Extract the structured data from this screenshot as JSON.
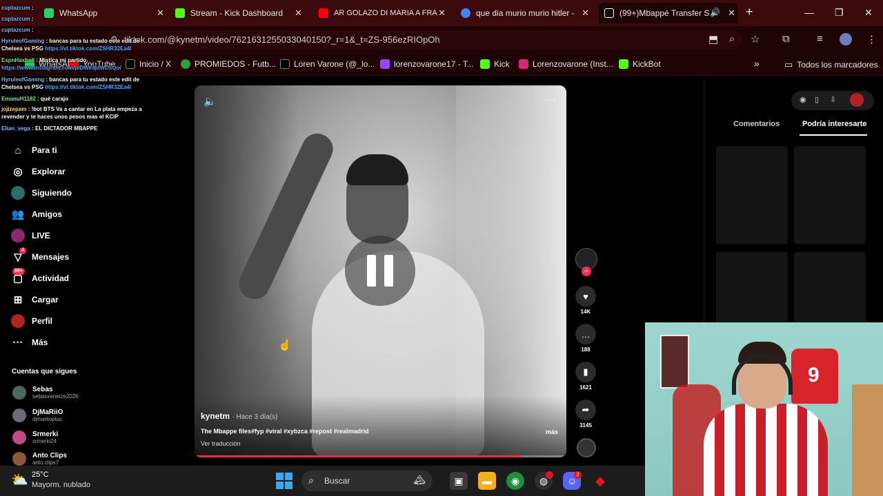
{
  "tabs": [
    {
      "label": "WhatsApp",
      "color": "#25d366"
    },
    {
      "label": "Stream - Kick Dashboard",
      "color": "#53fc18"
    },
    {
      "label": "AR GOLAZO DI MARIA A FRA",
      "color": "#ff0000"
    },
    {
      "label": "que dia murio murio hitler -",
      "color": "#4285f4"
    },
    {
      "label": "(99+)Mbappé Transfer S",
      "color": "#111111"
    }
  ],
  "address": {
    "url": "tiktok.com/@kynetm/video/7621631255033040150?_r=1&_t=ZS-956ezRIOpOh"
  },
  "bookmarks": [
    {
      "label": "WhatsApp",
      "color": "#25d366"
    },
    {
      "label": "YouTube",
      "color": "#ff0000"
    },
    {
      "label": "Inicio / X",
      "color": "#000000"
    },
    {
      "label": "PROMIEDOS - Futb...",
      "color": "#2e9d3a"
    },
    {
      "label": "Loren Varone (@_lo...",
      "color": "#000000"
    },
    {
      "label": "lorenzovarone17 - T...",
      "color": "#9146ff"
    },
    {
      "label": "Kick",
      "color": "#53fc18"
    },
    {
      "label": "Lorenzovarone (Inst...",
      "color": "#d62976"
    },
    {
      "label": "KickBot",
      "color": "#53fc18"
    }
  ],
  "all_bookmarks": "Todos los marcadores",
  "chat": [
    {
      "user": "cuptazcum",
      "msg": ":",
      "link": ""
    },
    {
      "user": "cuptazcum",
      "msg": ":",
      "link": ""
    },
    {
      "user": "cuptazcum",
      "msg": ":",
      "link": ""
    },
    {
      "user": "HyruleofGaming",
      "msg": ": bancas para tu estado este edit de Chelsea vs PSG",
      "link": "https://vt.tiktok.com/ZSHR32Ea4/"
    },
    {
      "user": "EspnHaxball",
      "msg": ": Mistica mi partido",
      "link": "https://www.instagram.com/p/DWeajdWDsQo/"
    },
    {
      "user": "HyruleofGaming",
      "msg": ": bancas para tu estado este edit de Chelsea vs PSG",
      "link": "https://vt.tiktok.com/ZSHR32Ea4/"
    },
    {
      "user": "EmanuH1182",
      "msg": ": qué carajo",
      "link": ""
    },
    {
      "user": "jojizepam",
      "msg": ": !bot BTS Va a cantar en La plata empeza a revender y te haces unos pesos mas el KCIP",
      "link": ""
    },
    {
      "user": "Elian_vega",
      "msg": ": EL DICTADOR MBAPPE",
      "link": ""
    }
  ],
  "sidebar": {
    "items": [
      {
        "label": "Para ti",
        "icon": "home-icon"
      },
      {
        "label": "Explorar",
        "icon": "compass-icon"
      },
      {
        "label": "Siguiendo",
        "icon": "following-icon"
      },
      {
        "label": "Amigos",
        "icon": "friends-icon"
      },
      {
        "label": "LIVE",
        "icon": "live-icon"
      },
      {
        "label": "Mensajes",
        "icon": "messages-icon",
        "badge": "4"
      },
      {
        "label": "Actividad",
        "icon": "activity-icon",
        "badge": "99+"
      },
      {
        "label": "Cargar",
        "icon": "upload-icon"
      },
      {
        "label": "Perfil",
        "icon": "profile-icon"
      },
      {
        "label": "Más",
        "icon": "more-icon"
      }
    ],
    "following_title": "Cuentas que sigues",
    "following": [
      {
        "name": "Sebas",
        "user": "sebasxeneize2026"
      },
      {
        "name": "DjMaRiiO",
        "user": "djmariioplus"
      },
      {
        "name": "Srmerki",
        "user": "srmerki24"
      },
      {
        "name": "Anto Clips",
        "user": "anto.clips7"
      }
    ]
  },
  "video": {
    "author": "kynetm",
    "time": "· Hace 3 día(s)",
    "caption": "The Mbappe files#fyp #viral #xybzca #repost #realmadrid",
    "translate": "Ver traducción",
    "more": "más",
    "progress": 0.88
  },
  "actions": {
    "likes": "14K",
    "comments": "188",
    "saves": "1621",
    "shares": "3145"
  },
  "right_panel": {
    "tab_comments": "Comentarios",
    "tab_interest": "Podría interesarte"
  },
  "taskbar": {
    "temp": "25°C",
    "weather": "Mayorm. nublado",
    "search": "Buscar"
  }
}
